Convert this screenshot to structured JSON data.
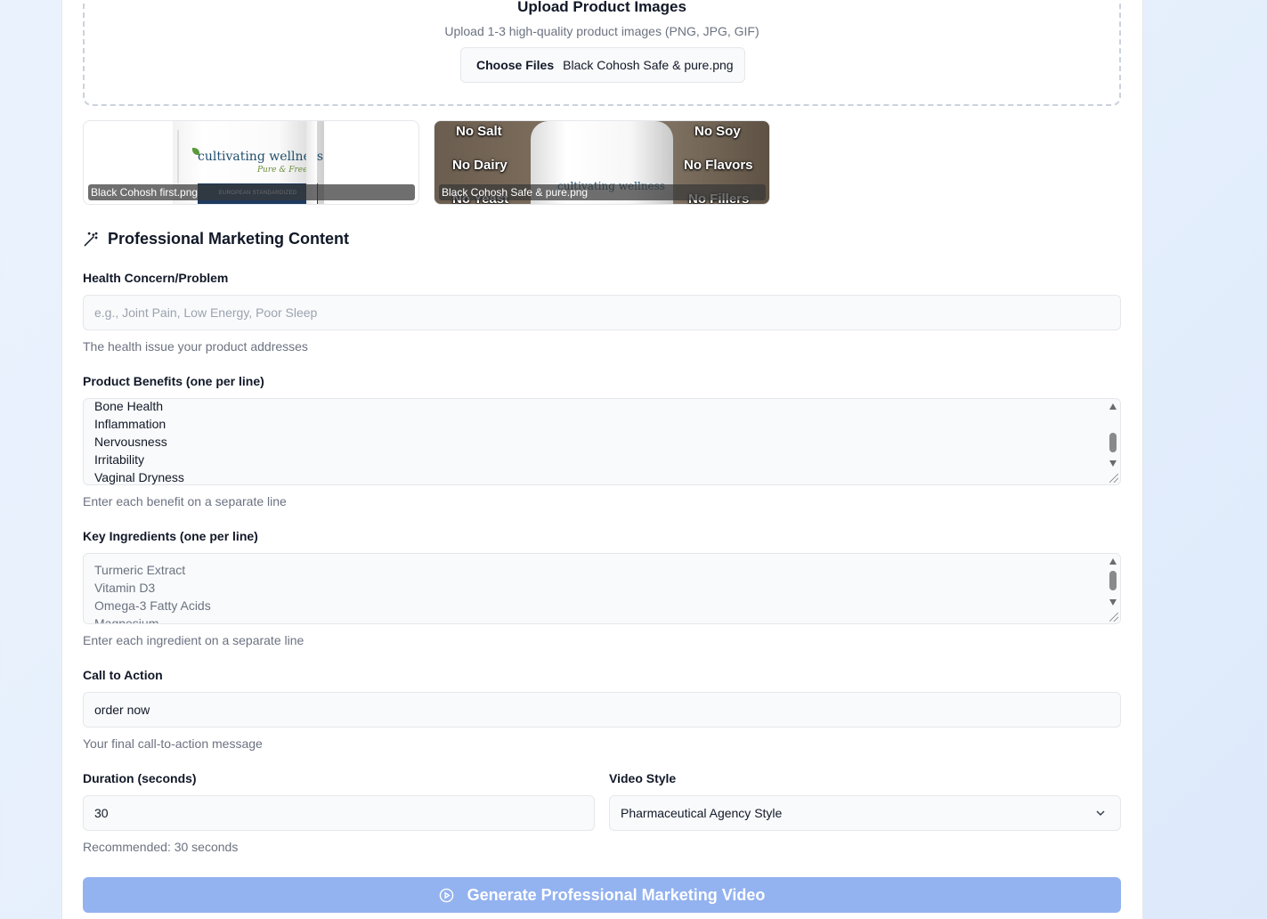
{
  "upload": {
    "title": "Upload Product Images",
    "hint": "Upload 1-3 high-quality product images (PNG, JPG, GIF)",
    "choose_label": "Choose Files",
    "chosen_file": "Black Cohosh Safe & pure.png"
  },
  "thumbnails": [
    {
      "caption": "Black Cohosh first.png",
      "brand_text": "cultivating wellness",
      "script_text": "Pure & Free",
      "band_text": "EUROPEAN STANDARDIZED"
    },
    {
      "caption": "Black Cohosh Safe & pure.png",
      "brand_text": "cultivating wellness",
      "overlay_words": [
        "No Salt",
        "No Soy",
        "No Dairy",
        "No Flavors",
        "No Yeast",
        "No Fillers"
      ]
    }
  ],
  "section": {
    "title": "Professional Marketing Content",
    "icon": "magic-wand-icon"
  },
  "health_concern": {
    "label": "Health Concern/Problem",
    "value": "",
    "placeholder": "e.g., Joint Pain, Low Energy, Poor Sleep",
    "help": "The health issue your product addresses"
  },
  "benefits": {
    "label": "Product Benefits (one per line)",
    "lines": [
      "Bone Health",
      "Inflammation",
      "Nervousness",
      "Irritability",
      "Vaginal Dryness"
    ],
    "help": "Enter each benefit on a separate line"
  },
  "ingredients": {
    "label": "Key Ingredients (one per line)",
    "placeholder_lines": [
      "Turmeric Extract",
      "Vitamin D3",
      "Omega-3 Fatty Acids",
      "Magnesium"
    ],
    "help": "Enter each ingredient on a separate line"
  },
  "cta": {
    "label": "Call to Action",
    "value": "order now",
    "help": "Your final call-to-action message"
  },
  "duration": {
    "label": "Duration (seconds)",
    "value": "30",
    "help": "Recommended: 30 seconds"
  },
  "video_style": {
    "label": "Video Style",
    "selected": "Pharmaceutical Agency Style"
  },
  "generate_button": {
    "label": "Generate Professional Marketing Video",
    "icon": "play-circle-icon"
  },
  "colors": {
    "primary_disabled": "#93b2f0",
    "page_background": "#e6f0fc",
    "card_background": "#ffffff",
    "field_background": "#f9fafb"
  }
}
